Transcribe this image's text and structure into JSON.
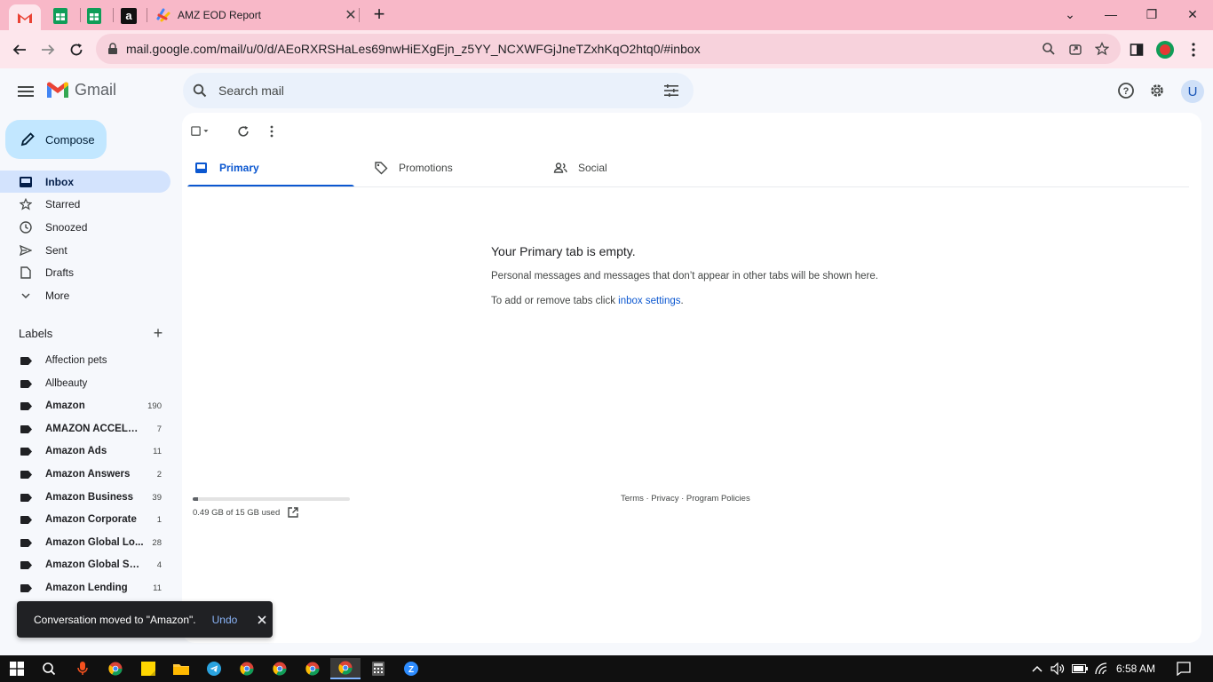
{
  "browser": {
    "active_tab_title": "AMZ EOD Report",
    "url": "mail.google.com/mail/u/0/d/AEoRXRSHaLes69nwHiEXgEjn_z5YY_NCXWFGjJneTZxhKqO2htq0/#inbox",
    "new_tab_symbol": "+",
    "close_symbol": "✕",
    "window_controls": {
      "minimize": "—",
      "restore": "❐",
      "close": "✕",
      "tab_list": "⌄"
    }
  },
  "gmail": {
    "logo_text": "Gmail",
    "search_placeholder": "Search mail",
    "avatar_letter": "U",
    "compose_label": "Compose"
  },
  "sidebar": {
    "nav": [
      {
        "label": "Inbox",
        "icon": "inbox-icon",
        "active": true
      },
      {
        "label": "Starred",
        "icon": "star-icon"
      },
      {
        "label": "Snoozed",
        "icon": "clock-icon"
      },
      {
        "label": "Sent",
        "icon": "send-icon"
      },
      {
        "label": "Drafts",
        "icon": "draft-icon"
      },
      {
        "label": "More",
        "icon": "chevron-down-icon"
      }
    ],
    "labels_heading": "Labels",
    "labels_add": "+",
    "labels": [
      {
        "name": "Affection pets",
        "count": "",
        "bold": false
      },
      {
        "name": "Allbeauty",
        "count": "",
        "bold": false
      },
      {
        "name": "Amazon",
        "count": "190",
        "bold": true
      },
      {
        "name": "AMAZON ACCELER...",
        "count": "7",
        "bold": true
      },
      {
        "name": "Amazon Ads",
        "count": "11",
        "bold": true
      },
      {
        "name": "Amazon Answers",
        "count": "2",
        "bold": true
      },
      {
        "name": "Amazon Business",
        "count": "39",
        "bold": true
      },
      {
        "name": "Amazon Corporate",
        "count": "1",
        "bold": true
      },
      {
        "name": "Amazon Global Lo...",
        "count": "28",
        "bold": true
      },
      {
        "name": "Amazon Global Sell...",
        "count": "4",
        "bold": true
      },
      {
        "name": "Amazon Lending",
        "count": "11",
        "bold": true
      }
    ]
  },
  "main": {
    "tabs": [
      {
        "label": "Primary",
        "icon": "inbox-icon",
        "active": true
      },
      {
        "label": "Promotions",
        "icon": "tag-icon",
        "active": false
      },
      {
        "label": "Social",
        "icon": "people-icon",
        "active": false
      }
    ],
    "empty_title": "Your Primary tab is empty.",
    "empty_desc": "Personal messages and messages that don’t appear in other tabs will be shown here.",
    "empty_hint_prefix": "To add or remove tabs click ",
    "empty_hint_link": "inbox settings",
    "empty_hint_suffix": ".",
    "storage_text": "0.49 GB of 15 GB used",
    "storage_fraction": 0.033,
    "footer": "Terms · Privacy · Program Policies"
  },
  "snackbar": {
    "message": "Conversation moved to \"Amazon\".",
    "undo": "Undo"
  },
  "taskbar": {
    "time": "6:58 AM"
  },
  "colors": {
    "tabstrip": "#f8b8c8",
    "toolbar": "#fde6ec",
    "accent": "#0b57d0",
    "compose": "#c2e7ff",
    "active_nav": "#d3e3fd"
  }
}
